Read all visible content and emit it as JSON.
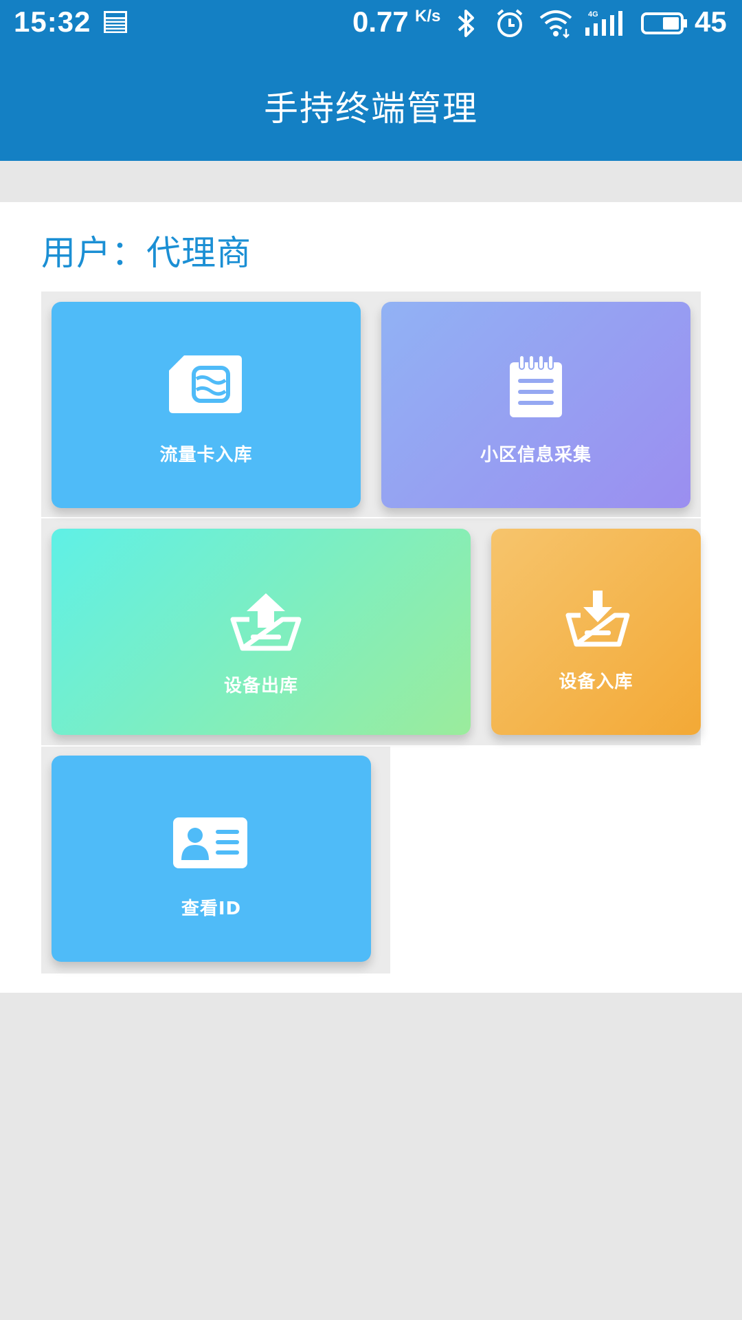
{
  "status_bar": {
    "time": "15:32",
    "news_icon": "news-icon",
    "speed": "0.77",
    "speed_unit": "K/s",
    "battery_level": "45"
  },
  "app_bar": {
    "title": "手持终端管理"
  },
  "user": {
    "label": "用户：代理商"
  },
  "tiles": [
    {
      "label": "流量卡入库",
      "icon": "sim-card-icon",
      "color": "#4fbbf8"
    },
    {
      "label": "小区信息采集",
      "icon": "notepad-icon",
      "colors": [
        "#91b2f4",
        "#9b8ef0"
      ]
    },
    {
      "label": "设备出库",
      "icon": "upload-basket-icon",
      "colors": [
        "#5ff0e6",
        "#9bec9c"
      ]
    },
    {
      "label": "设备入库",
      "icon": "download-basket-icon",
      "colors": [
        "#f6c46c",
        "#f3a936"
      ]
    },
    {
      "label": "查看ID",
      "icon": "id-card-icon",
      "color": "#4fbbf8"
    }
  ],
  "colors": {
    "primary": "#1480c4",
    "user_text": "#1b8fd4",
    "page_bg": "#e7e7e7"
  }
}
